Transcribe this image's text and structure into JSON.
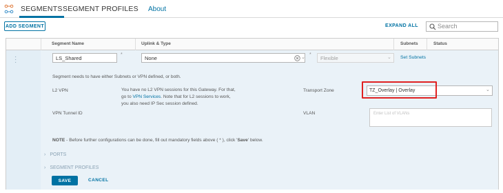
{
  "nav": {
    "tabs": [
      "SEGMENTS",
      "SEGMENT PROFILES"
    ],
    "separator": "-",
    "about": "About"
  },
  "toolbar": {
    "add_segment": "ADD SEGMENT",
    "expand_all": "EXPAND ALL",
    "search_placeholder": "Search"
  },
  "grid": {
    "columns": [
      "Segment Name",
      "Uplink & Type",
      "Subnets",
      "Status"
    ]
  },
  "row": {
    "segment_name": "LS_Shared",
    "uplink_value": "None",
    "type_value": "Flexible",
    "set_subnets": "Set Subnets",
    "required_mark": "*",
    "message": "Segment needs to have either Subnets or VPN defined, or both.",
    "l2vpn_label": "L2 VPN",
    "l2vpn_text_1": "You have no L2 VPN sessions for this Gateway. For that,",
    "l2vpn_text_2a": "go to ",
    "l2vpn_link": "VPN Services",
    "l2vpn_text_2b": ". Note that for L2 sessions to work,",
    "l2vpn_text_3": "you also need IP Sec session defined.",
    "transport_zone_label": "Transport Zone",
    "transport_zone_value": "TZ_Overlay | Overlay",
    "vpn_tunnel_id_label": "VPN Tunnel ID",
    "vlan_label": "VLAN",
    "vlan_placeholder": "Enter List of VLANs",
    "note_bold": "NOTE",
    "note_text": " - Before further configurations can be done, fill out mandatory fields above ( * ), click '",
    "note_save": "Save",
    "note_end": "' below.",
    "ports": "PORTS",
    "segment_profiles": "SEGMENT PROFILES",
    "save": "SAVE",
    "cancel": "CANCEL"
  },
  "colors": {
    "accent": "#0072a3",
    "highlight": "#e02020",
    "row_bg": "#eaf2f8"
  }
}
